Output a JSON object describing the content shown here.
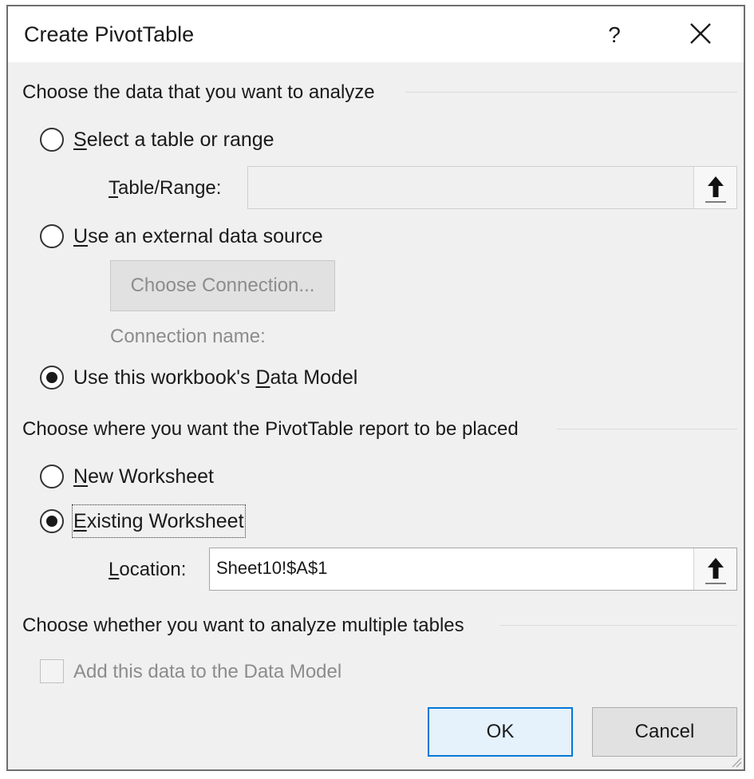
{
  "dialog": {
    "title": "Create PivotTable",
    "help_label": "?"
  },
  "data_source": {
    "heading": "Choose the data that you want to analyze",
    "options": [
      {
        "label": "Select a table or range",
        "selected": false
      },
      {
        "label": "Use an external data source",
        "selected": false
      },
      {
        "label": "Use this workbook's Data Model",
        "selected": true
      }
    ],
    "table_range_label": "Table/Range:",
    "table_range_value": "",
    "choose_connection_label": "Choose Connection...",
    "connection_name_label": "Connection name:"
  },
  "placement": {
    "heading": "Choose where you want the PivotTable report to be placed",
    "options": [
      {
        "label": "New Worksheet",
        "selected": false
      },
      {
        "label": "Existing Worksheet",
        "selected": true
      }
    ],
    "location_label": "Location:",
    "location_value": "Sheet10!$A$1"
  },
  "multiple_tables": {
    "heading": "Choose whether you want to analyze multiple tables",
    "add_to_model_label": "Add this data to the Data Model",
    "add_to_model_checked": false
  },
  "buttons": {
    "ok": "OK",
    "cancel": "Cancel"
  },
  "icons": [
    "help-icon",
    "close-icon",
    "collapse-dialog-icon",
    "resize-grip-icon"
  ]
}
